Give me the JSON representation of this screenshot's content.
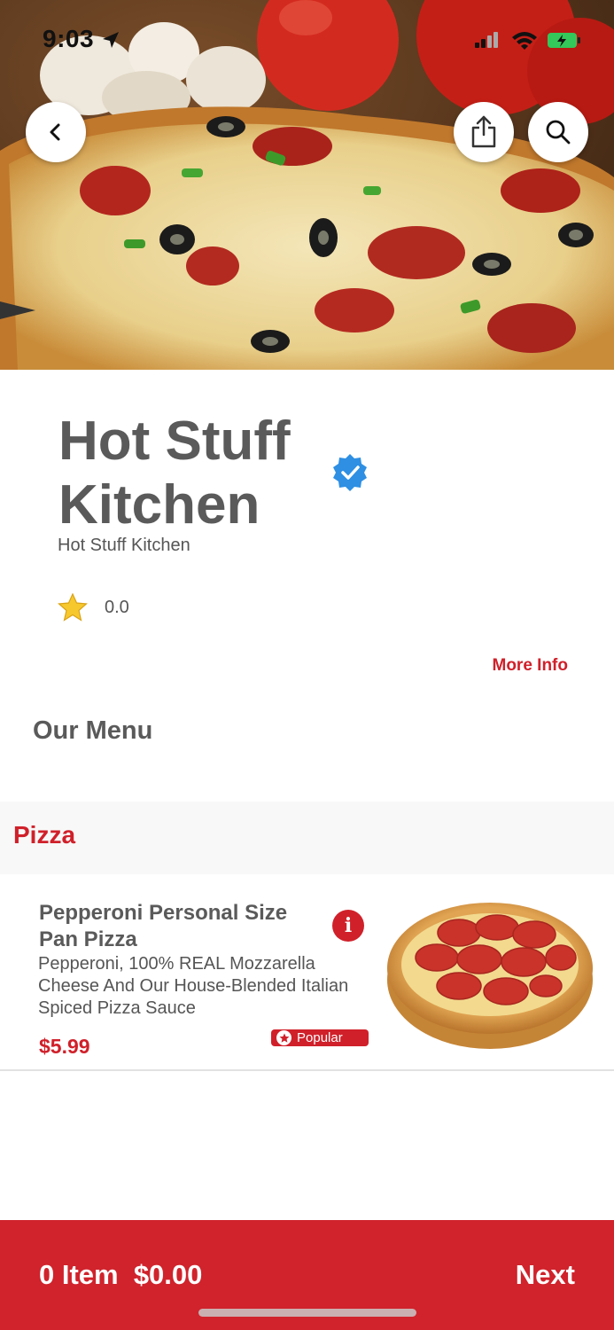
{
  "status_bar": {
    "time": "9:03",
    "icons": [
      "location-arrow-icon",
      "signal-icon",
      "wifi-icon",
      "battery-charging-icon"
    ]
  },
  "hero": {
    "image": "pizza-hero-photo",
    "buttons": [
      "back-icon",
      "share-icon",
      "search-icon"
    ]
  },
  "restaurant": {
    "name": "Hot Stuff Kitchen",
    "subtitle": "Hot Stuff Kitchen",
    "verified_icon": "verified-badge-icon",
    "rating": "0.0",
    "more_info_label": "More Info"
  },
  "menu": {
    "heading": "Our Menu",
    "categories": [
      {
        "label": "Pizza",
        "items": [
          {
            "name": "Pepperoni Personal Size Pan Pizza",
            "description": "Pepperoni, 100% REAL Mozzarella Cheese And Our House-Blended Italian Spiced Pizza Sauce",
            "price": "$5.99",
            "badge": "Popular",
            "image": "pepperoni-pizza"
          }
        ]
      }
    ]
  },
  "footer": {
    "cart_summary": "0 Item  $0.00",
    "next_label": "Next"
  },
  "colors": {
    "accent": "#d0202a",
    "verified": "#2e8fe3",
    "text": "#5a5a5a",
    "category_bg": "#f8f8f8"
  }
}
